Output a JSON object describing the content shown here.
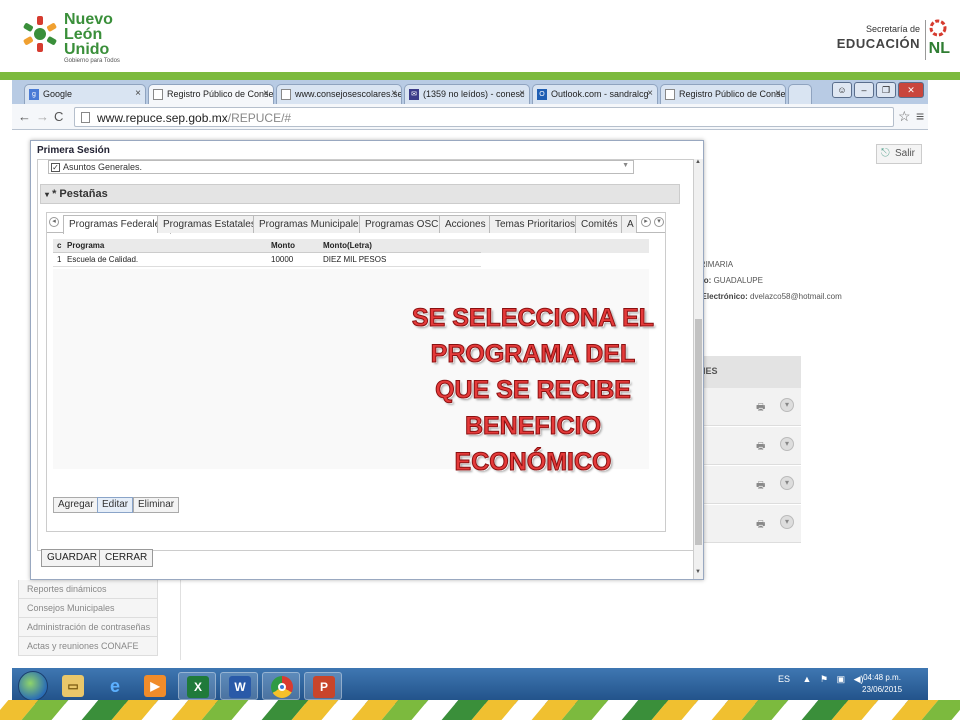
{
  "header": {
    "brand_lines": [
      "Nuevo",
      "León",
      "Unido"
    ],
    "brand_tagline": "Gobierno para Todos",
    "sep_line1": "Secretaría de",
    "sep_line2": "EDUCACIÓN",
    "sep_abbrev": "NL"
  },
  "browser": {
    "tabs": [
      {
        "label": "Google",
        "icon": "g"
      },
      {
        "label": "Registro Público de Conse",
        "icon": ""
      },
      {
        "label": "www.consejosescolares.se",
        "icon": ""
      },
      {
        "label": "(1359 no leídos) - conesc",
        "icon": "m"
      },
      {
        "label": "Outlook.com - sandralcg",
        "icon": "o"
      },
      {
        "label": "Registro Público de Conse",
        "icon": ""
      }
    ],
    "url_host": "www.repuce.sep.gob.mx",
    "url_path": "/REPUCE/#"
  },
  "page": {
    "salir": "Salir",
    "info_nivel": "PRIMARIA",
    "info_municipio_label": "cipio:",
    "info_municipio": "GUADALUPE",
    "info_email_label": "eo Electrónico:",
    "info_email": "dvelazco58@hotmail.com",
    "panel_label": "ONES",
    "side_menu": [
      "Reportes dinámicos",
      "Consejos Municipales",
      "Administración de contraseñas",
      "Actas y reuniones CONAFE"
    ]
  },
  "dialog": {
    "title": "Primera Sesión",
    "asuntos": "Asuntos Generales.",
    "pestanas": "* Pestañas",
    "tabs": [
      "Programas Federales",
      "Programas Estatales",
      "Programas Municipales",
      "Programas OSC",
      "Acciones",
      "Temas Prioritarios",
      "Comités",
      "A"
    ],
    "grid_headers": [
      "c",
      "Programa",
      "Monto",
      "Monto(Letra)"
    ],
    "grid_rows": [
      [
        "1",
        "Escuela de Calidad.",
        "10000",
        "DIEZ MIL PESOS"
      ]
    ],
    "grid_buttons": [
      "Agregar",
      "Editar",
      "Eliminar"
    ],
    "save_label": "GUARDAR",
    "close_label": "CERRAR"
  },
  "callout": {
    "lines": [
      "SE SELECCIONA EL",
      "PROGRAMA DEL",
      "QUE SE RECIBE",
      "BENEFICIO",
      "ECONÓMICO"
    ]
  },
  "taskbar": {
    "language": "ES",
    "time": "04:48 p.m.",
    "date": "23/06/2015"
  },
  "colors": {
    "callout_red": "#e43a3a",
    "brand_green": "#7cba3e"
  }
}
